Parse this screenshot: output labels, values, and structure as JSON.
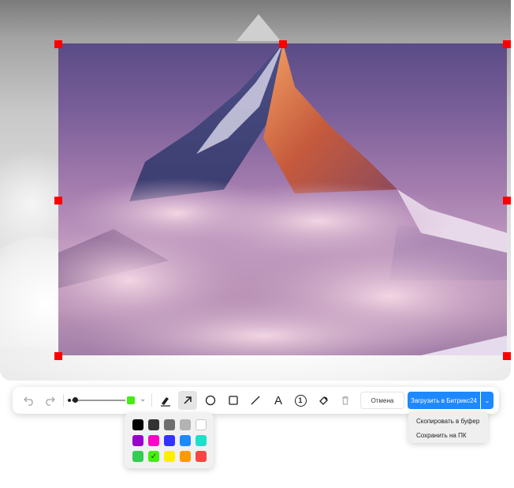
{
  "toolbar": {
    "undo_icon": "undo-icon",
    "redo_icon": "redo-icon",
    "selected_color": "#44ee11",
    "tools": [
      "marker-icon",
      "arrow-icon",
      "circle-icon",
      "rectangle-icon",
      "line-icon",
      "text-icon",
      "number-icon",
      "blur-icon",
      "trash-icon"
    ],
    "active_tool": "arrow-icon",
    "text_tool_glyph": "A",
    "number_tool_glyph": "1",
    "cancel_label": "Отмена",
    "upload_label": "Загрузить в Битрикс24"
  },
  "upload_menu": {
    "items": [
      "Скопировать в буфер",
      "Сохранить на ПК"
    ]
  },
  "palette": {
    "colors": [
      [
        "#000000",
        "#333333",
        "#6e6e6e",
        "#b3b3b3",
        "#ffffff"
      ],
      [
        "#9900cc",
        "#ff00cc",
        "#3333ff",
        "#1e88ff",
        "#22ddcc"
      ],
      [
        "#33cc55",
        "#44ee11",
        "#ffee00",
        "#ff9900",
        "#ff4444"
      ]
    ],
    "selected_mark": "✓"
  }
}
